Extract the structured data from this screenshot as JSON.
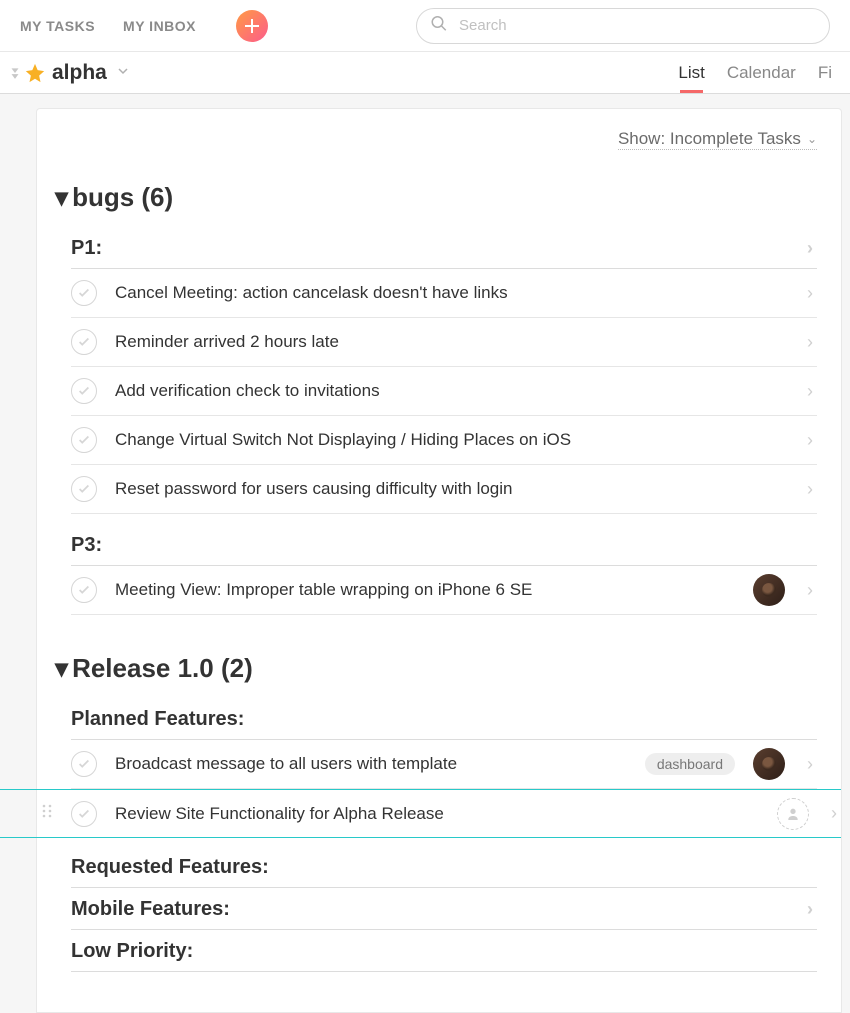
{
  "topnav": {
    "my_tasks": "MY TASKS",
    "my_inbox": "MY INBOX"
  },
  "search": {
    "placeholder": "Search"
  },
  "project": {
    "name": "alpha"
  },
  "view_tabs": {
    "list": "List",
    "calendar": "Calendar",
    "files": "Fi"
  },
  "filter": {
    "label": "Show: Incomplete Tasks"
  },
  "sections": [
    {
      "title": "bugs (6)",
      "groups": [
        {
          "heading": "P1:",
          "tasks": [
            {
              "title": "Cancel Meeting: action cancelask doesn't have links"
            },
            {
              "title": "Reminder arrived 2 hours late"
            },
            {
              "title": "Add verification check to invitations"
            },
            {
              "title": "Change Virtual Switch Not Displaying / Hiding Places on iOS"
            },
            {
              "title": "Reset password for users causing difficulty with login"
            }
          ]
        },
        {
          "heading": "P3:",
          "tasks": [
            {
              "title": "Meeting View: Improper table wrapping on iPhone 6 SE",
              "avatar": true
            }
          ]
        }
      ]
    },
    {
      "title": "Release 1.0 (2)",
      "groups": [
        {
          "heading": "Planned Features:",
          "tasks": [
            {
              "title": "Broadcast message to all users with template",
              "tag": "dashboard",
              "avatar": true
            },
            {
              "title": "Review Site Functionality for Alpha Release",
              "highlight": true,
              "emptyAvatar": true
            }
          ]
        },
        {
          "heading": "Requested Features:",
          "tasks": []
        },
        {
          "heading": "Mobile Features:",
          "tasks": []
        },
        {
          "heading": "Low Priority:",
          "tasks": []
        }
      ]
    }
  ]
}
